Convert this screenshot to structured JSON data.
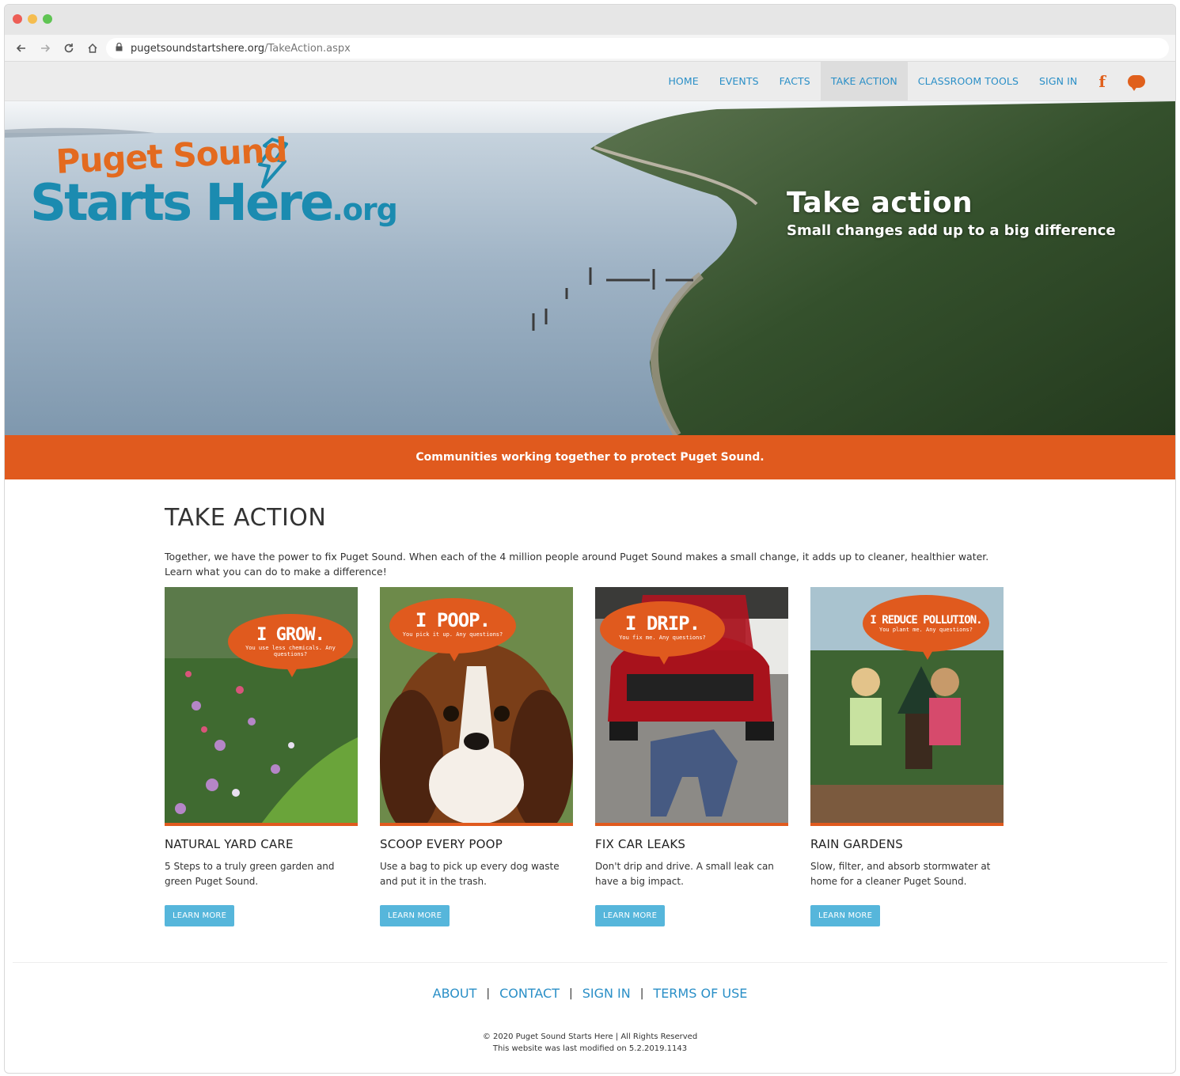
{
  "browser": {
    "url_host": "pugetsoundstartshere.org",
    "url_path": "/TakeAction.aspx",
    "traffic_colors": [
      "#ed5e56",
      "#f5bd4f",
      "#5fc453"
    ]
  },
  "nav": {
    "items": [
      {
        "label": "HOME"
      },
      {
        "label": "EVENTS"
      },
      {
        "label": "FACTS"
      },
      {
        "label": "TAKE ACTION"
      },
      {
        "label": "CLASSROOM TOOLS"
      },
      {
        "label": "SIGN IN"
      }
    ],
    "facebook_glyph": "f"
  },
  "logo": {
    "line1": "Puget Sound",
    "line2": "Starts Here",
    "suffix": ".org"
  },
  "hero": {
    "title": "Take action",
    "subtitle": "Small changes add up to a big difference"
  },
  "banner": {
    "text": "Communities working together to protect Puget Sound."
  },
  "main": {
    "title": "TAKE ACTION",
    "intro": "Together, we have the power to fix Puget Sound. When each of the 4 million people around Puget Sound makes a small change, it adds up to cleaner, healthier water. Learn what you can do to make a difference!"
  },
  "cards": [
    {
      "bubble_big": "I GROW.",
      "bubble_small": "You use less chemicals. Any questions?",
      "title": "NATURAL YARD CARE",
      "desc": "5 Steps to a truly green garden and green Puget Sound.",
      "button": "LEARN MORE"
    },
    {
      "bubble_big": "I POOP.",
      "bubble_small": "You pick it up. Any questions?",
      "title": "SCOOP EVERY POOP",
      "desc": "Use a bag to pick up every dog waste and put it in the trash.",
      "button": "LEARN MORE"
    },
    {
      "bubble_big": "I DRIP.",
      "bubble_small": "You fix me. Any questions?",
      "title": "FIX CAR LEAKS",
      "desc": "Don't drip and drive. A small leak can have a big impact.",
      "button": "LEARN MORE"
    },
    {
      "bubble_big": "I REDUCE POLLUTION.",
      "bubble_small": "You plant me. Any questions?",
      "title": "RAIN GARDENS",
      "desc": "Slow, filter, and absorb stormwater at home for a cleaner Puget Sound.",
      "button": "LEARN MORE"
    }
  ],
  "footer": {
    "links": [
      {
        "label": "ABOUT"
      },
      {
        "label": "CONTACT"
      },
      {
        "label": "SIGN IN"
      },
      {
        "label": "TERMS OF USE"
      }
    ],
    "separator": "|",
    "copyright": "© 2020 Puget Sound Starts Here | All Rights Reserved",
    "modified": "This website was last modified on 5.2.2019.1143"
  },
  "colors": {
    "accent_orange": "#e05a1e",
    "link_blue": "#2a8fc7",
    "button_blue": "#56b6db",
    "logo_blue": "#1b8bb0"
  }
}
